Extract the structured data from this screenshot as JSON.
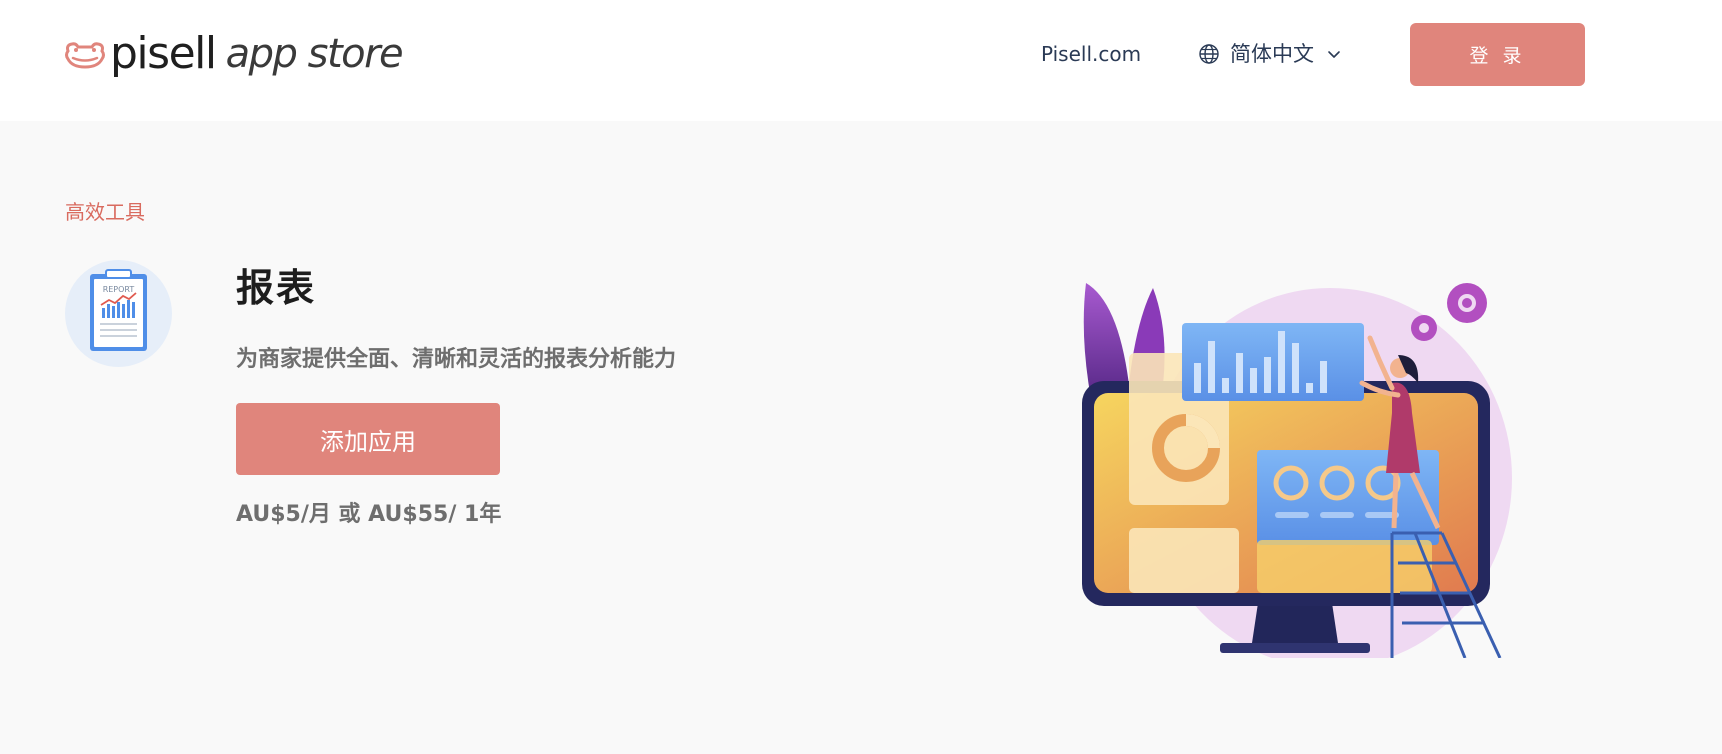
{
  "header": {
    "logo_word": "pisell",
    "logo_sub": "app store",
    "nav_link": "Pisell.com",
    "language": "简体中文",
    "login_label": "登 录"
  },
  "app": {
    "category": "高效工具",
    "title": "报表",
    "description": "为商家提供全面、清晰和灵活的报表分析能力",
    "add_button_label": "添加应用",
    "price": "AU$5/月 或 AU$55/ 1年",
    "icon_text": "REPORT"
  },
  "colors": {
    "accent": "#e0857c",
    "category_text": "#d96b5f",
    "nav_text": "#2a3a55",
    "page_bg": "#f9f9f9"
  },
  "icons": {
    "logo": "frog-logo-icon",
    "language": "globe-icon",
    "dropdown": "chevron-down-icon",
    "app": "report-clipboard-icon"
  }
}
